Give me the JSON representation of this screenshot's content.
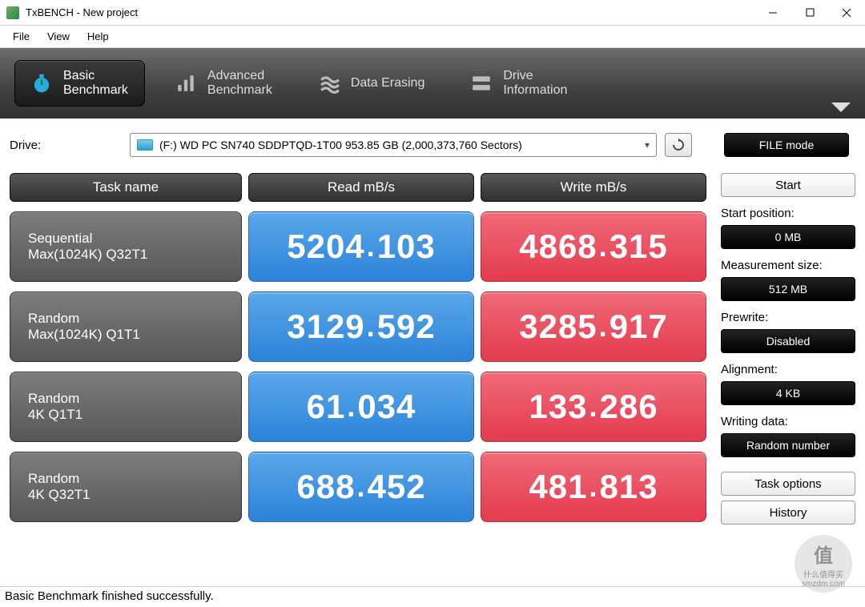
{
  "window": {
    "title": "TxBENCH - New project"
  },
  "menu": {
    "file": "File",
    "view": "View",
    "help": "Help"
  },
  "tabs": {
    "basic": {
      "line1": "Basic",
      "line2": "Benchmark"
    },
    "advanced": {
      "line1": "Advanced",
      "line2": "Benchmark"
    },
    "erase": {
      "line1": "Data Erasing"
    },
    "drive": {
      "line1": "Drive",
      "line2": "Information"
    }
  },
  "drive": {
    "label": "Drive:",
    "selected": "(F:) WD PC SN740 SDDPTQD-1T00  953.85 GB (2,000,373,760 Sectors)",
    "file_mode": "FILE mode"
  },
  "headers": {
    "task": "Task name",
    "read": "Read mB/s",
    "write": "Write mB/s"
  },
  "rows": [
    {
      "name1": "Sequential",
      "name2": "Max(1024K) Q32T1",
      "read_int": "5204",
      "read_frac": "103",
      "write_int": "4868",
      "write_frac": "315"
    },
    {
      "name1": "Random",
      "name2": "Max(1024K) Q1T1",
      "read_int": "3129",
      "read_frac": "592",
      "write_int": "3285",
      "write_frac": "917"
    },
    {
      "name1": "Random",
      "name2": "4K Q1T1",
      "read_int": "61",
      "read_frac": "034",
      "write_int": "133",
      "write_frac": "286"
    },
    {
      "name1": "Random",
      "name2": "4K Q32T1",
      "read_int": "688",
      "read_frac": "452",
      "write_int": "481",
      "write_frac": "813"
    }
  ],
  "side": {
    "start": "Start",
    "start_pos_label": "Start position:",
    "start_pos_value": "0 MB",
    "meas_label": "Measurement size:",
    "meas_value": "512 MB",
    "prewrite_label": "Prewrite:",
    "prewrite_value": "Disabled",
    "align_label": "Alignment:",
    "align_value": "4 KB",
    "writing_label": "Writing data:",
    "writing_value": "Random number",
    "task_options": "Task options",
    "history": "History"
  },
  "status": "Basic Benchmark finished successfully.",
  "watermark": {
    "char": "值",
    "text": "什么值得买",
    "domain": "smzdm.com"
  }
}
